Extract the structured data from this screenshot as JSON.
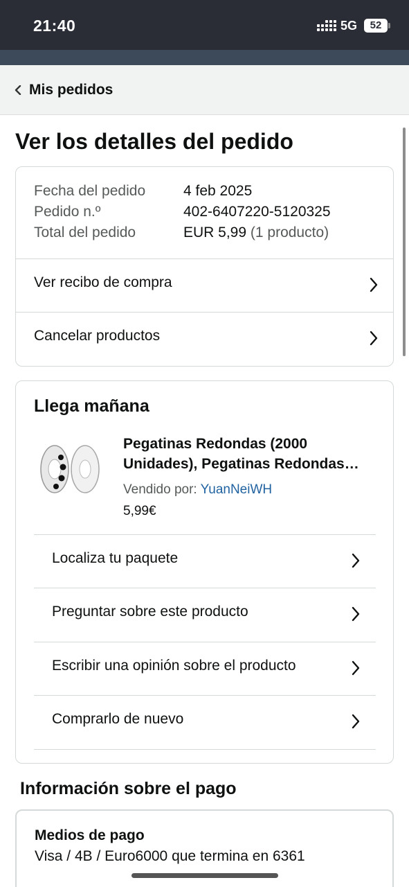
{
  "status_bar": {
    "time": "21:40",
    "network": "5G",
    "battery": "52"
  },
  "breadcrumb": {
    "label": "Mis pedidos"
  },
  "page_title": "Ver los detalles del pedido",
  "summary": {
    "rows": [
      {
        "label": "Fecha del pedido",
        "value": "4 feb 2025"
      },
      {
        "label": "Pedido n.º",
        "value": "402-6407220-5120325"
      },
      {
        "label": "Total del pedido",
        "value": "EUR 5,99",
        "extra": "(1 producto)"
      }
    ],
    "links": [
      {
        "label": "Ver recibo de compra"
      },
      {
        "label": "Cancelar productos"
      }
    ]
  },
  "delivery": {
    "title": "Llega mañana",
    "product": {
      "name": "Pegatinas Redondas (2000 Unidades), Pegatinas Redondas…",
      "sold_by_label": "Vendido por:",
      "seller": "YuanNeiWH",
      "price": "5,99€"
    },
    "actions": [
      {
        "label": "Localiza tu paquete"
      },
      {
        "label": "Preguntar sobre este producto"
      },
      {
        "label": "Escribir una opinión sobre el producto"
      },
      {
        "label": "Comprarlo de nuevo"
      }
    ]
  },
  "payment": {
    "section_title": "Información sobre el pago",
    "method_label": "Medios de pago",
    "method_value": "Visa / 4B / Euro6000  que termina en 6361"
  },
  "colors": {
    "link": "#2162a1",
    "status_bar": "#2a2d36",
    "text": "#0f1111",
    "muted": "#565959"
  }
}
